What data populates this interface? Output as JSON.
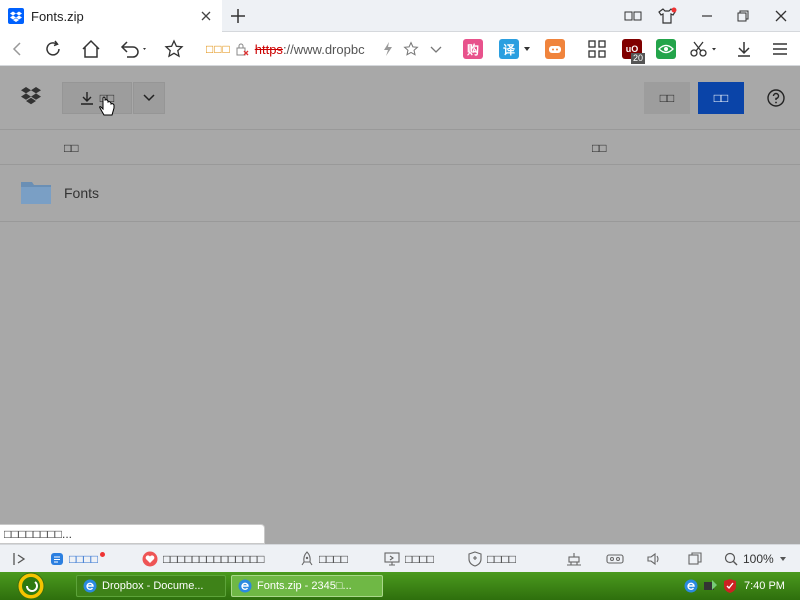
{
  "browser": {
    "tab": {
      "title": "Fonts.zip",
      "favicon": "dropbox-icon"
    },
    "window_controls": [
      "sidebar-icon",
      "shirt-icon",
      "minimize-icon",
      "restore-icon",
      "close-icon"
    ],
    "address": {
      "security_text": "□□□",
      "url_scheme": "https",
      "url_rest": "://www.dropbc"
    },
    "extension_labels": {
      "shopping": "购",
      "translate": "译",
      "ublock_count": "20"
    }
  },
  "app": {
    "download_label": "□□",
    "secondary_button_label": "□□",
    "primary_button_label": "□□",
    "columns": {
      "name": "□□",
      "modified": "□□"
    },
    "rows": [
      {
        "name": "Fonts",
        "type": "folder"
      }
    ]
  },
  "status_popup": "□□□□□□□□...",
  "statusbar": {
    "item1": "□□□□",
    "item2": "□□□□□□□□□□□□□□",
    "item3": "□□□□",
    "item4": "□□□□",
    "item5": "□□□□",
    "zoom": "100%"
  },
  "taskbar": {
    "tasks": [
      {
        "label": "Dropbox - Docume..."
      },
      {
        "label": "Fonts.zip - 2345□..."
      }
    ],
    "clock": "7:40 PM"
  },
  "colors": {
    "primary_button": "#0a44a8",
    "folder": "#6a8fb5",
    "taskbar": "#3a8215"
  }
}
